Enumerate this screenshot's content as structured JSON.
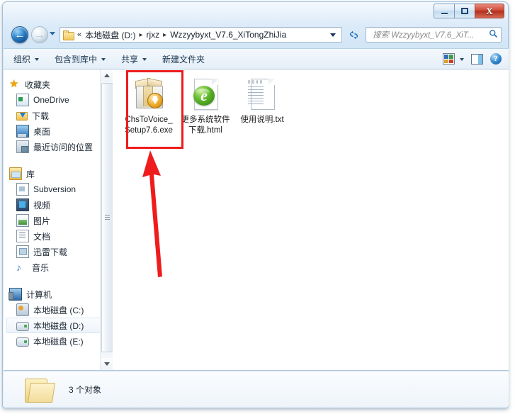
{
  "window": {
    "title": "",
    "buttons": {
      "minimize": "—",
      "maximize": "□",
      "close": "X"
    }
  },
  "nav": {
    "back_label": "←",
    "forward_label": "→",
    "history_label": "",
    "refresh_label": "↺"
  },
  "address": {
    "overflow": "«",
    "crumbs": [
      "本地磁盘 (D:)",
      "rjxz",
      "Wzzyybyxt_V7.6_XiTongZhiJia"
    ],
    "separator": "▸"
  },
  "search": {
    "placeholder": "搜索 Wzzyybyxt_V7.6_XiT...",
    "icon": "⌕"
  },
  "toolbar": {
    "items": [
      {
        "label": "组织",
        "caret": true
      },
      {
        "label": "包含到库中",
        "caret": true
      },
      {
        "label": "共享",
        "caret": true
      },
      {
        "label": "新建文件夹",
        "caret": false
      }
    ],
    "help_label": "?"
  },
  "sidebar": {
    "groups": [
      {
        "root": {
          "label": "收藏夹",
          "icon": "star-icon"
        },
        "items": [
          {
            "label": "OneDrive",
            "icon": "onedrive-icon"
          },
          {
            "label": "下载",
            "icon": "download-folder-icon"
          },
          {
            "label": "桌面",
            "icon": "desktop-icon"
          },
          {
            "label": "最近访问的位置",
            "icon": "recent-places-icon"
          }
        ]
      },
      {
        "root": {
          "label": "库",
          "icon": "library-icon"
        },
        "items": [
          {
            "label": "Subversion",
            "icon": "subversion-icon"
          },
          {
            "label": "视频",
            "icon": "video-icon"
          },
          {
            "label": "图片",
            "icon": "picture-icon"
          },
          {
            "label": "文档",
            "icon": "document-icon"
          },
          {
            "label": "迅雷下载",
            "icon": "thunder-download-icon"
          },
          {
            "label": "音乐",
            "icon": "music-icon"
          }
        ]
      },
      {
        "root": {
          "label": "计算机",
          "icon": "computer-icon"
        },
        "items": [
          {
            "label": "本地磁盘 (C:)",
            "icon": "system-drive-icon",
            "selected": false
          },
          {
            "label": "本地磁盘 (D:)",
            "icon": "drive-icon",
            "selected": true
          },
          {
            "label": "本地磁盘 (E:)",
            "icon": "drive-icon",
            "selected": false
          }
        ]
      }
    ]
  },
  "files": [
    {
      "name": "ChsToVoice_Setup7.6.exe",
      "icon": "exe-installer-icon",
      "highlighted": true
    },
    {
      "name": "更多系统软件下载.html",
      "icon": "html-ie-icon",
      "highlighted": false
    },
    {
      "name": "使用说明.txt",
      "icon": "text-file-icon",
      "highlighted": false
    }
  ],
  "status": {
    "text": "3 个对象"
  },
  "annotation": {
    "highlight_color": "#ee1c1c",
    "arrow_color": "#ee1c1c"
  },
  "colors": {
    "accent": "#1f6fb5",
    "window_border": "#9fc0dd",
    "close_button": "#cf4a38"
  }
}
